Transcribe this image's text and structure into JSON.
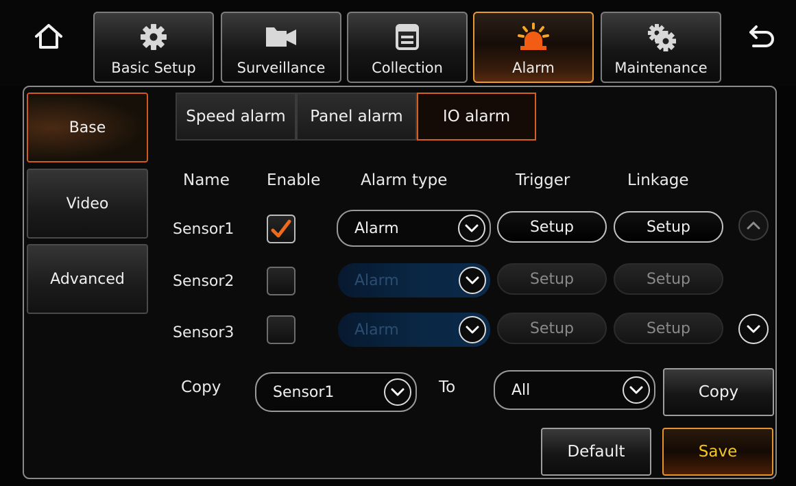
{
  "nav": {
    "tabs": [
      {
        "label": "Basic Setup",
        "icon": "gear-icon"
      },
      {
        "label": "Surveillance",
        "icon": "camera-icon"
      },
      {
        "label": "Collection",
        "icon": "document-icon"
      },
      {
        "label": "Alarm",
        "icon": "alarm-light-icon",
        "active": true
      },
      {
        "label": "Maintenance",
        "icon": "gears-icon"
      }
    ]
  },
  "sidebar": {
    "items": [
      {
        "label": "Base",
        "active": true
      },
      {
        "label": "Video"
      },
      {
        "label": "Advanced"
      }
    ]
  },
  "subtabs": [
    {
      "label": "Speed alarm"
    },
    {
      "label": "Panel alarm"
    },
    {
      "label": "IO alarm",
      "active": true
    }
  ],
  "table": {
    "headers": [
      "Name",
      "Enable",
      "Alarm type",
      "Trigger",
      "Linkage"
    ],
    "rows": [
      {
        "name": "Sensor1",
        "enabled": true,
        "alarm_type": "Alarm",
        "trigger": "Setup",
        "linkage": "Setup"
      },
      {
        "name": "Sensor2",
        "enabled": false,
        "alarm_type": "Alarm",
        "trigger": "Setup",
        "linkage": "Setup"
      },
      {
        "name": "Sensor3",
        "enabled": false,
        "alarm_type": "Alarm",
        "trigger": "Setup",
        "linkage": "Setup"
      }
    ]
  },
  "copy": {
    "label": "Copy",
    "source": "Sensor1",
    "to_label": "To",
    "target": "All",
    "button": "Copy"
  },
  "footer": {
    "default_label": "Default",
    "save_label": "Save"
  },
  "colors": {
    "active_border": "#ea9a34",
    "save_text": "#f3c81a",
    "check": "#f06a1c",
    "disabled_fill": "#0a2744"
  }
}
